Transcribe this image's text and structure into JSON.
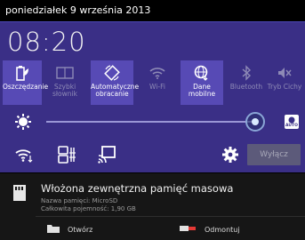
{
  "status_bar": {
    "date": "poniedziałek 9 września 2013"
  },
  "panel": {
    "clock": "08:20",
    "tiles": [
      {
        "label": "Oszczędzanie",
        "state": "on",
        "icon": "battery-leaf-icon"
      },
      {
        "label": "Szybki słownik",
        "state": "off",
        "icon": "dictionary-icon"
      },
      {
        "label": "Automatyczne obracanie",
        "state": "on",
        "icon": "auto-rotate-icon"
      },
      {
        "label": "Wi-Fi",
        "state": "off",
        "icon": "wifi-icon"
      },
      {
        "label": "Dane mobilne",
        "state": "on",
        "icon": "mobile-data-icon"
      },
      {
        "label": "Bluetooth",
        "state": "off",
        "icon": "bluetooth-icon"
      },
      {
        "label": "Tryb Cichy",
        "state": "off",
        "icon": "silent-mode-icon"
      }
    ],
    "brightness": {
      "level": 0.95,
      "auto_label": "AUTO"
    },
    "quick_row": {
      "icons": [
        "wifi-settings-icon",
        "sim-settings-icon",
        "screen-mirroring-icon",
        "settings-gear-icon"
      ],
      "button_label": "Wyłącz"
    }
  },
  "notification": {
    "title": "Włożona zewnętrzna pamięć masowa",
    "line1": "Nazwa pamięci: MicroSD",
    "line2": "Całkowita pojemność: 1,90 GB",
    "actions": [
      {
        "label": "Otwórz",
        "icon": "folder-icon"
      },
      {
        "label": "Odmontuj",
        "icon": "eject-card-icon"
      }
    ]
  },
  "colors": {
    "panel_bg": "#3a2f86",
    "tile_on": "#574ab5",
    "notification_bg": "#161616"
  }
}
